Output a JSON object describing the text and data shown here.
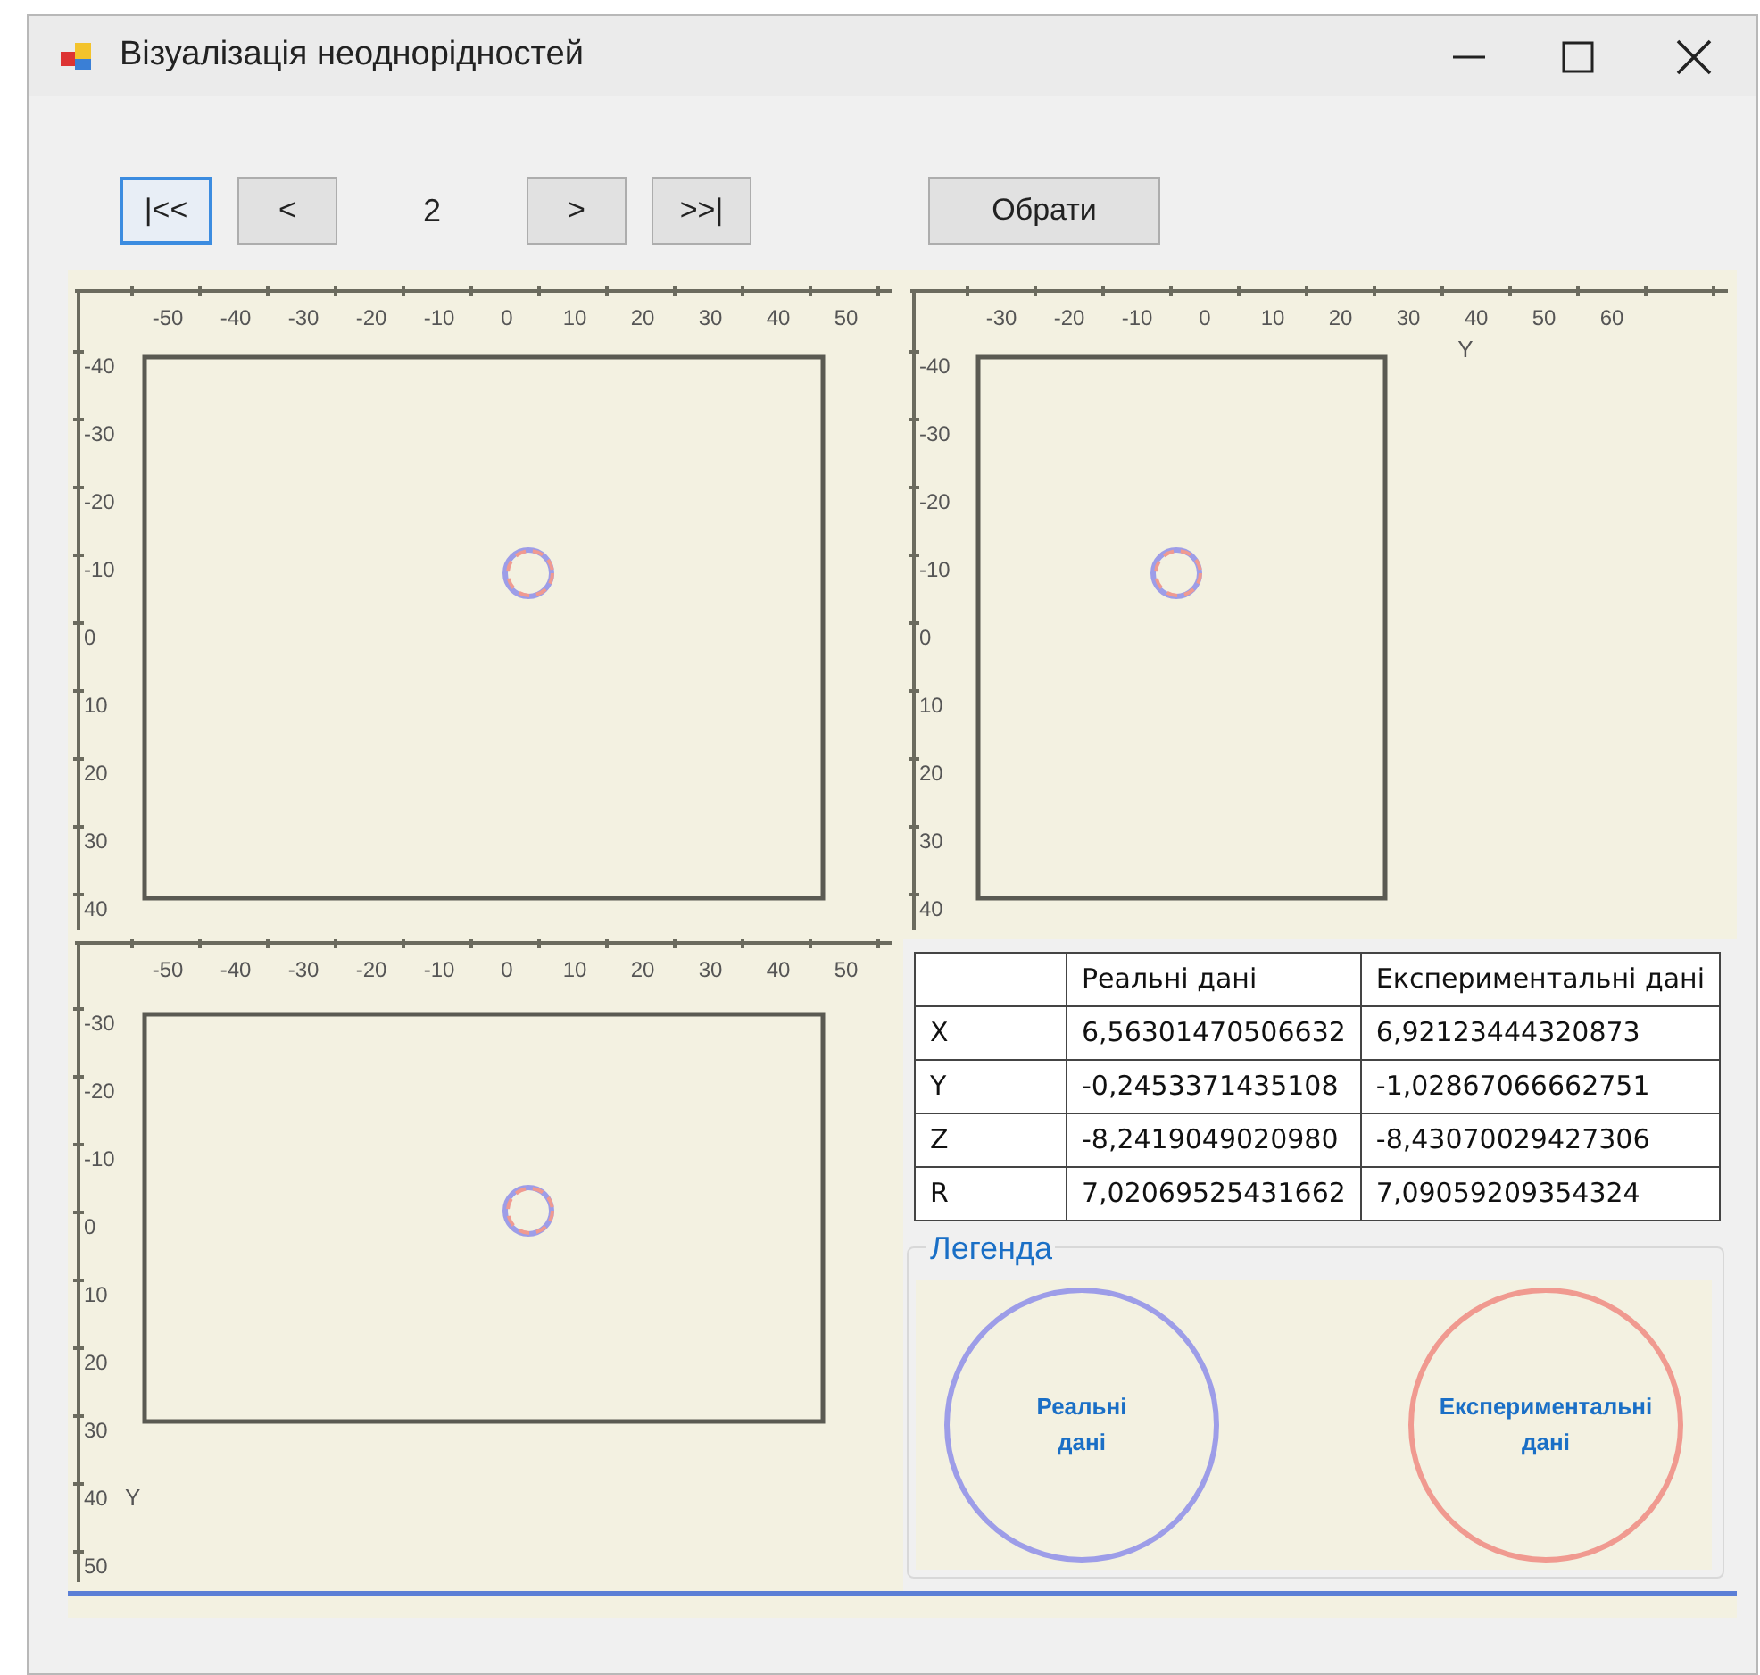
{
  "window": {
    "title": "Візуалізація неоднорідностей"
  },
  "pager": {
    "buttons": [
      {
        "label": "|<<",
        "focused": true
      },
      {
        "label": "<",
        "focused": false
      }
    ],
    "page": "2",
    "buttons_after": [
      {
        "label": ">",
        "focused": false
      },
      {
        "label": ">>|",
        "focused": false
      }
    ]
  },
  "select_button": {
    "label": "Обрати"
  },
  "plots": [
    {
      "x_ticks": [
        "-50",
        "-40",
        "-30",
        "-20",
        "-10",
        "0",
        "10",
        "20",
        "30",
        "40",
        "50"
      ],
      "y_ticks": [
        "-40",
        "-30",
        "-20",
        "-10",
        "0",
        "10",
        "20",
        "30",
        "40"
      ]
    },
    {
      "x_ticks": [
        "-30",
        "-20",
        "-10",
        "0",
        "10",
        "20",
        "30",
        "40",
        "50",
        "60"
      ],
      "y_ticks": [
        "-40",
        "-30",
        "-20",
        "-10",
        "0",
        "10",
        "20",
        "30",
        "40"
      ],
      "axis_label": "Y"
    },
    {
      "x_ticks": [
        "-50",
        "-40",
        "-30",
        "-20",
        "-10",
        "0",
        "10",
        "20",
        "30",
        "40",
        "50"
      ],
      "y_ticks": [
        "-30",
        "-20",
        "-10",
        "0",
        "10",
        "20",
        "30",
        "40",
        "50"
      ],
      "axis_label": "Y"
    }
  ],
  "table": {
    "columns": [
      "Реальні дані",
      "Експериментальні дані"
    ],
    "rows": [
      {
        "label": "X",
        "values": [
          "6,56301470506632",
          "6,92123444320873"
        ]
      },
      {
        "label": "Y",
        "values": [
          "-0,2453371435108",
          "-1,02867066662751"
        ]
      },
      {
        "label": "Z",
        "values": [
          "-8,2419049020980",
          "-8,43070029427306"
        ]
      },
      {
        "label": "R",
        "values": [
          "7,02069525431662",
          "7,09059209354324"
        ]
      }
    ]
  },
  "legend": {
    "title": "Легенда",
    "items": [
      {
        "label": "Реальні дані",
        "color": "#9d9de8"
      },
      {
        "label": "Експериментальні дані",
        "color": "#f09a90"
      }
    ]
  }
}
